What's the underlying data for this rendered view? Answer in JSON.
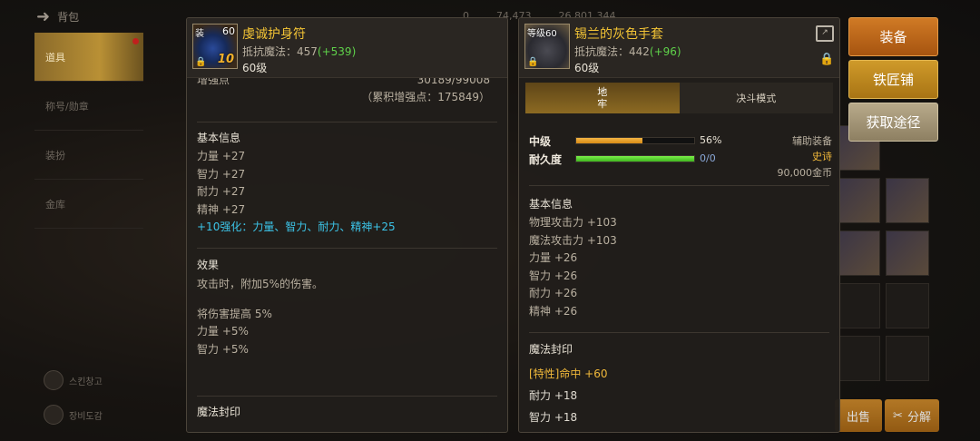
{
  "nav": {
    "back_label": "背包",
    "items": [
      {
        "label": "道具",
        "active": true
      },
      {
        "label": "称号/勋章"
      },
      {
        "label": "装扮"
      },
      {
        "label": "金库"
      }
    ],
    "bottom": [
      "스킨창고",
      "장비도감"
    ]
  },
  "topbar": {
    "values": [
      "0",
      "74,473",
      "26,801,344"
    ]
  },
  "left_item": {
    "name": "虔诚护身符",
    "icon_level": "60",
    "icon_label": "装",
    "icon_enhance": "10",
    "resist_label": "抵抗魔法：",
    "resist_value": "457",
    "resist_bonus": "(+539)",
    "level": "60级",
    "enhance_points_label": "增强点",
    "enhance_points": "30189/99008",
    "accum_points": "（累积增强点：175849）",
    "basic_title": "基本信息",
    "basic_stats": [
      "力量 +27",
      "智力 +27",
      "耐力 +27",
      "精神 +27"
    ],
    "enhance_line": "+10强化：力量、智力、耐力、精神+25",
    "effect_title": "效果",
    "effect_lines": [
      "攻击时，附加5%的伤害。"
    ],
    "effect_lines2": [
      "将伤害提高 5%",
      "力量 +5%",
      "智力 +5%"
    ],
    "seal_title": "魔法封印"
  },
  "right_item": {
    "name": "锡兰的灰色手套",
    "icon_label": "等级60",
    "resist_label": "抵抗魔法：",
    "resist_value": "442",
    "resist_bonus": "(+96)",
    "level": "60级",
    "tabs": [
      "地牢",
      "决斗模式"
    ],
    "grade_label": "中级",
    "grade_percent": 56,
    "grade_value": "56%",
    "durability_label": "耐久度",
    "durability_value": "0/0",
    "type": "辅助装备",
    "rarity": "史诗",
    "price": "90,000金币",
    "basic_title": "基本信息",
    "basic_stats": [
      "物理攻击力 +103",
      "魔法攻击力 +103",
      "力量 +26",
      "智力 +26",
      "耐力 +26",
      "精神 +26"
    ],
    "seal_title": "魔法封印",
    "seal_lines": [
      "[特性]命中 +60",
      "耐力 +18",
      "智力 +18"
    ]
  },
  "buttons": {
    "equip": "装备",
    "smith": "铁匠铺",
    "source": "获取途径",
    "sell": "出售",
    "disassemble": "分解"
  },
  "colors": {
    "item_name": "#f2c335",
    "bonus_green": "#5fd24a",
    "enhance_cyan": "#3cc4e8",
    "seal_gold": "#f0b83a",
    "equip_orange": "#d07a25"
  }
}
